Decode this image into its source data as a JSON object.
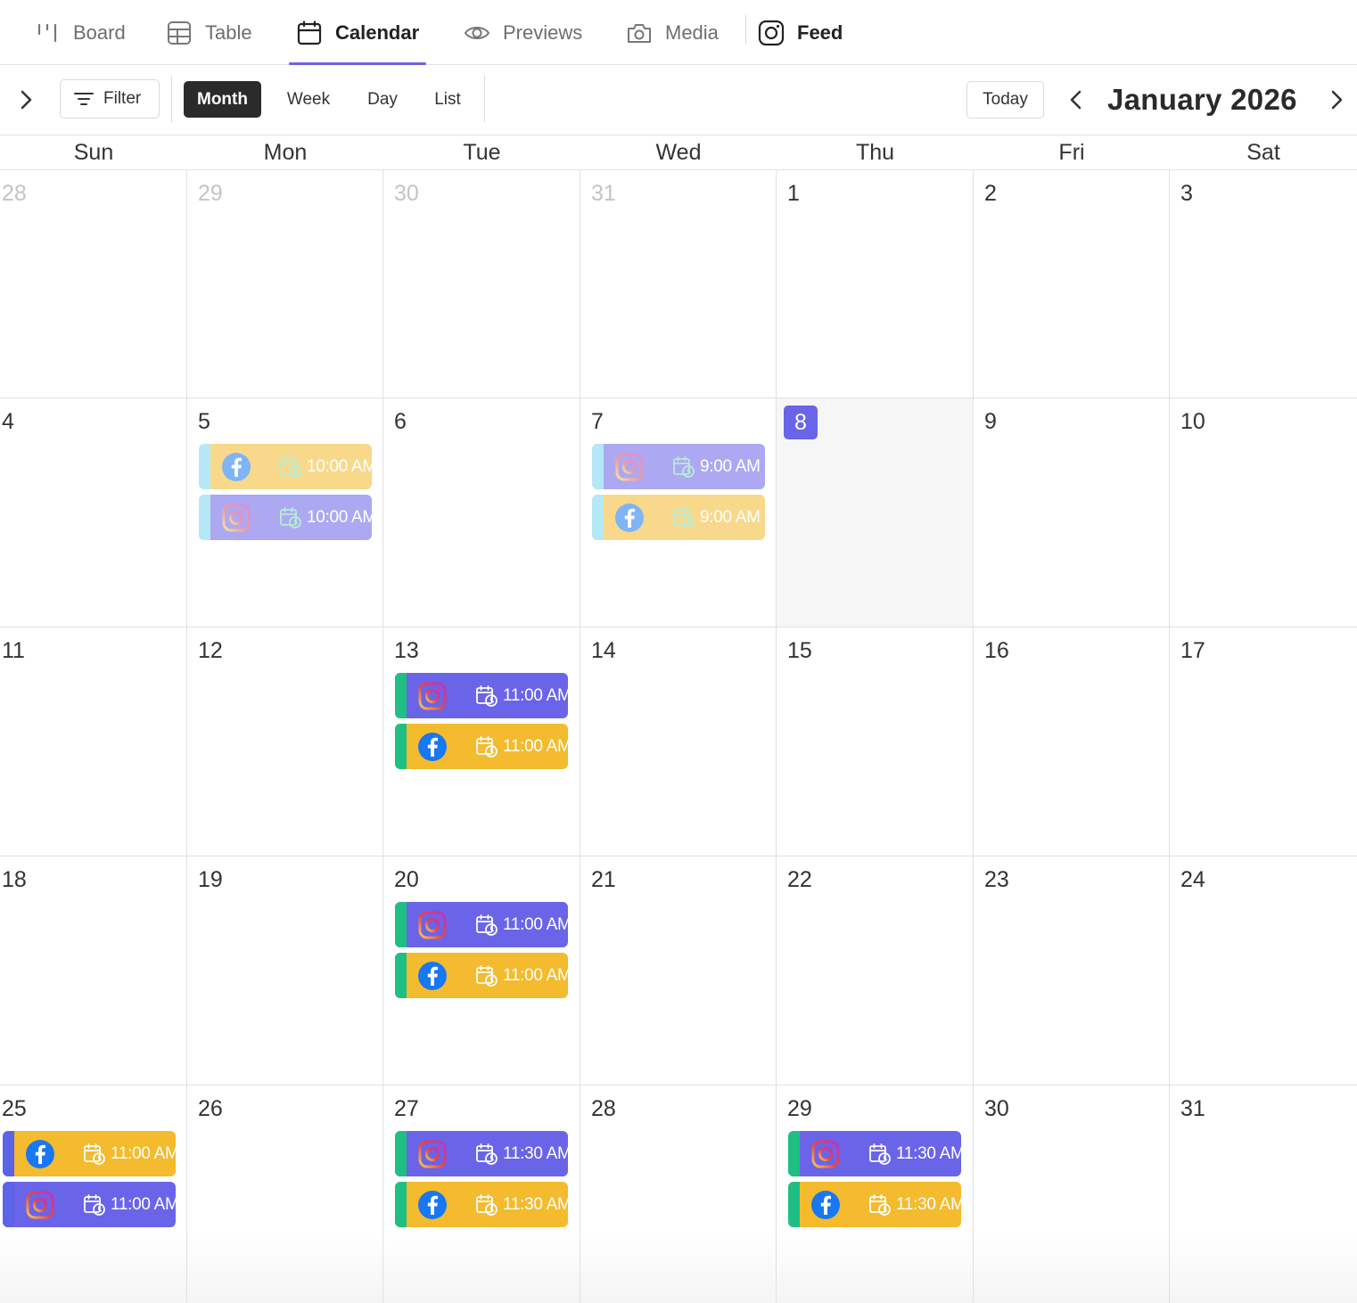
{
  "colors": {
    "accent": "#6a64e8",
    "instagram_event": "#6a64e8",
    "facebook_event": "#f3bb2d",
    "bar_green": "#1fbf83",
    "bar_cyan": "#7ad6f0",
    "bar_blue": "#5b63e8"
  },
  "view_tabs": [
    {
      "label": "Board",
      "icon": "board-icon",
      "active": false
    },
    {
      "label": "Table",
      "icon": "table-icon",
      "active": false
    },
    {
      "label": "Calendar",
      "icon": "calendar-icon",
      "active": true
    },
    {
      "label": "Previews",
      "icon": "eye-icon",
      "active": false
    },
    {
      "label": "Media",
      "icon": "camera-icon",
      "active": false
    },
    {
      "label": "Feed",
      "icon": "instagram-icon",
      "active": false
    }
  ],
  "toolbar": {
    "filter_label": "Filter",
    "view_modes": [
      {
        "label": "Month",
        "active": true
      },
      {
        "label": "Week",
        "active": false
      },
      {
        "label": "Day",
        "active": false
      },
      {
        "label": "List",
        "active": false
      }
    ],
    "today_label": "Today",
    "month_title": "January 2026"
  },
  "calendar": {
    "weekdays": [
      "Sun",
      "Mon",
      "Tue",
      "Wed",
      "Thu",
      "Fri",
      "Sat"
    ],
    "weeks": [
      [
        {
          "day": "28",
          "other": true,
          "events": []
        },
        {
          "day": "29",
          "other": true,
          "events": []
        },
        {
          "day": "30",
          "other": true,
          "events": []
        },
        {
          "day": "31",
          "other": true,
          "events": []
        },
        {
          "day": "1",
          "events": []
        },
        {
          "day": "2",
          "events": []
        },
        {
          "day": "3",
          "events": []
        }
      ],
      [
        {
          "day": "4",
          "events": []
        },
        {
          "day": "5",
          "events": [
            {
              "platform": "facebook",
              "time": "10:00 AM",
              "bar": "cyan",
              "past": true
            },
            {
              "platform": "instagram",
              "time": "10:00 AM",
              "bar": "cyan",
              "past": true
            }
          ]
        },
        {
          "day": "6",
          "events": []
        },
        {
          "day": "7",
          "events": [
            {
              "platform": "instagram",
              "time": "9:00 AM",
              "bar": "cyan",
              "past": true
            },
            {
              "platform": "facebook",
              "time": "9:00 AM",
              "bar": "cyan",
              "past": true
            }
          ]
        },
        {
          "day": "8",
          "today": true,
          "events": []
        },
        {
          "day": "9",
          "events": []
        },
        {
          "day": "10",
          "events": []
        }
      ],
      [
        {
          "day": "11",
          "events": []
        },
        {
          "day": "12",
          "events": []
        },
        {
          "day": "13",
          "events": [
            {
              "platform": "instagram",
              "time": "11:00 AM",
              "bar": "green"
            },
            {
              "platform": "facebook",
              "time": "11:00 AM",
              "bar": "green"
            }
          ]
        },
        {
          "day": "14",
          "events": []
        },
        {
          "day": "15",
          "events": []
        },
        {
          "day": "16",
          "events": []
        },
        {
          "day": "17",
          "events": []
        }
      ],
      [
        {
          "day": "18",
          "events": []
        },
        {
          "day": "19",
          "events": []
        },
        {
          "day": "20",
          "events": [
            {
              "platform": "instagram",
              "time": "11:00 AM",
              "bar": "green"
            },
            {
              "platform": "facebook",
              "time": "11:00 AM",
              "bar": "green"
            }
          ]
        },
        {
          "day": "21",
          "events": []
        },
        {
          "day": "22",
          "events": []
        },
        {
          "day": "23",
          "events": []
        },
        {
          "day": "24",
          "events": []
        }
      ],
      [
        {
          "day": "25",
          "events": [
            {
              "platform": "facebook",
              "time": "11:00 AM",
              "bar": "blue"
            },
            {
              "platform": "instagram",
              "time": "11:00 AM",
              "bar": "blue"
            }
          ]
        },
        {
          "day": "26",
          "events": []
        },
        {
          "day": "27",
          "events": [
            {
              "platform": "instagram",
              "time": "11:30 AM",
              "bar": "green"
            },
            {
              "platform": "facebook",
              "time": "11:30 AM",
              "bar": "green"
            }
          ]
        },
        {
          "day": "28",
          "events": []
        },
        {
          "day": "29",
          "events": [
            {
              "platform": "instagram",
              "time": "11:30 AM",
              "bar": "green"
            },
            {
              "platform": "facebook",
              "time": "11:30 AM",
              "bar": "green"
            }
          ]
        },
        {
          "day": "30",
          "events": []
        },
        {
          "day": "31",
          "events": []
        }
      ]
    ]
  }
}
